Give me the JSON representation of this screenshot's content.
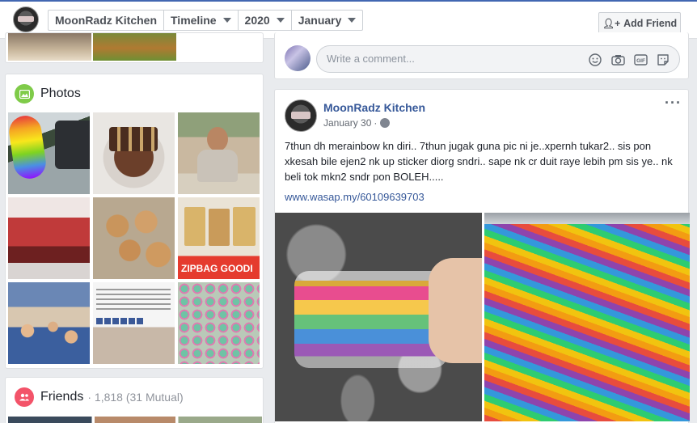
{
  "header": {
    "page_name": "MoonRadz Kitchen",
    "view": "Timeline",
    "year": "2020",
    "month": "January",
    "add_friend_label": "Add Friend"
  },
  "photos": {
    "title": "Photos",
    "items": [
      {
        "name": "rainbow-cookie-photo",
        "caption": ""
      },
      {
        "name": "cake-photo",
        "caption": ""
      },
      {
        "name": "child-photo",
        "caption": ""
      },
      {
        "name": "red-chairs-photo",
        "caption": ""
      },
      {
        "name": "buns-photo",
        "caption": ""
      },
      {
        "name": "zipbag-goodies-photo",
        "caption": "ZIPBAG GOODI"
      },
      {
        "name": "family-dinner-photo",
        "caption": ""
      },
      {
        "name": "event-poster-photo",
        "caption": ""
      },
      {
        "name": "cupcakes-photo",
        "caption": ""
      }
    ]
  },
  "friends": {
    "title": "Friends",
    "summary": "· 1,818 (31 Mutual)"
  },
  "comment": {
    "placeholder": "Write a comment..."
  },
  "post": {
    "author": "MoonRadz Kitchen",
    "date": "January 30",
    "text": "7thun dh merainbow kn diri.. 7thun jugak guna pic ni je..xpernh tukar2.. sis pon xkesah bile ejen2 nk up sticker diorg sndri.. sape nk cr duit raye lebih pm sis ye.. nk beli tok mkn2 sndr pon BOLEH.....",
    "link": "www.wasap.my/60109639703",
    "more": "···"
  },
  "colors": {
    "brand": "#4267b2",
    "link": "#365899",
    "photos_icon": "#7fcb49",
    "friends_icon": "#f35369"
  },
  "icons": [
    "add-friend-icon",
    "photos-icon",
    "friends-icon",
    "emoji-icon",
    "camera-icon",
    "gif-icon",
    "sticker-icon",
    "globe-icon",
    "more-icon"
  ]
}
